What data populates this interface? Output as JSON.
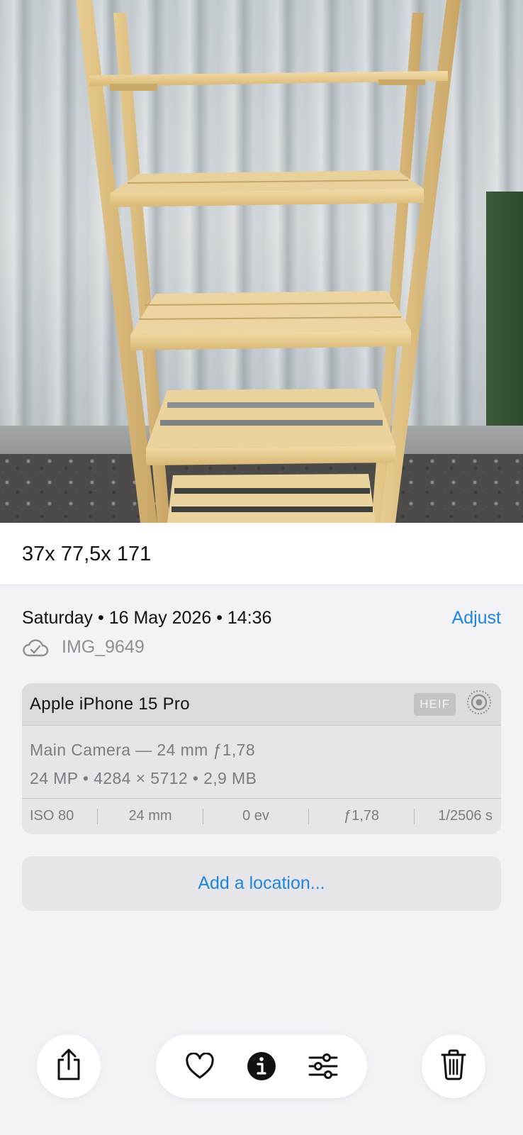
{
  "photo": {
    "icon": "shelf-photo"
  },
  "caption": "37x 77,5x 171",
  "info": {
    "date": "Saturday • 16 May 2026 • 14:36",
    "adjust_label": "Adjust",
    "filename": "IMG_9649",
    "file_icon": "cloud-check-icon"
  },
  "camera": {
    "device": "Apple iPhone 15 Pro",
    "format_badge": "HEIF",
    "lens": "Main Camera — 24 mm ƒ1,78",
    "details": "24 MP • 4284 × 5712 • 2,9 MB",
    "specs": [
      "ISO 80",
      "24 mm",
      "0 ev",
      "ƒ1,78",
      "1/2506 s"
    ]
  },
  "location_button": "Add a location...",
  "toolbar": {
    "share": "share-icon",
    "favorite": "heart-icon",
    "info": "info-icon",
    "edit": "sliders-icon",
    "delete": "trash-icon"
  },
  "colors": {
    "accent": "#1f86df",
    "background": "#f2f2f7"
  }
}
